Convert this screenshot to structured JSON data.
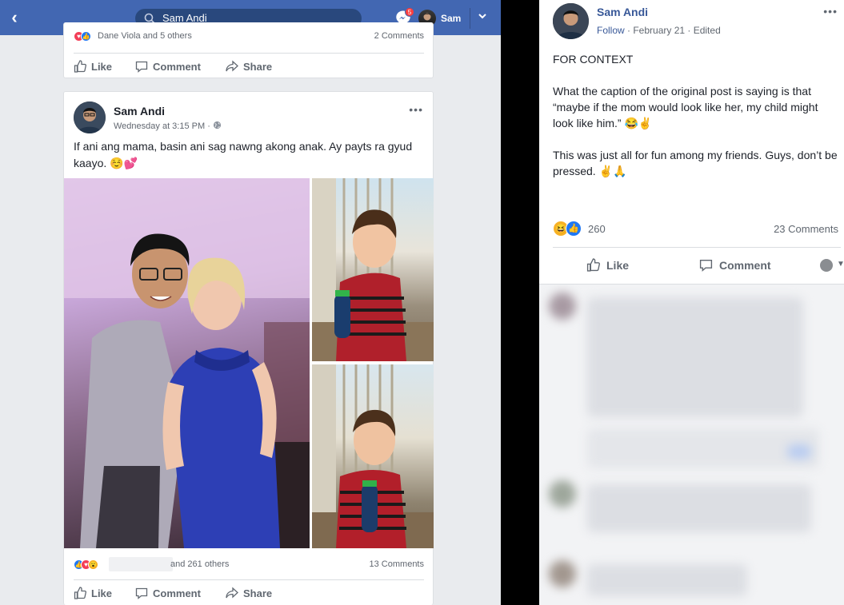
{
  "left_panel": {
    "topbar": {
      "search_value": "Sam Andi",
      "messenger_badge": "5",
      "profile_name": "Sam"
    },
    "previous_post": {
      "reactions_text": "Dane Viola and 5 others",
      "comments_count": "2 Comments",
      "actions": {
        "like": "Like",
        "comment": "Comment",
        "share": "Share"
      }
    },
    "post": {
      "author": "Sam Andi",
      "timestamp": "Wednesday at 3:15 PM · ",
      "text": "If ani ang mama, basin ani sag nawng akong anak. Ay payts ra gyud kaayo. ☺️💕",
      "reactions_text": "and 261 others",
      "comments_count": "13 Comments",
      "actions": {
        "like": "Like",
        "comment": "Comment",
        "share": "Share"
      }
    }
  },
  "right_panel": {
    "author": "Sam Andi",
    "follow": "Follow",
    "meta": " · February 21 · Edited",
    "text_heading": "FOR CONTEXT",
    "text_p1": "What the caption of the original post is saying is that “maybe if the mom would look like her, my child might look like him.” 😂✌️",
    "text_p2": "This was just all for fun among my friends. Guys, don’t be pressed. ✌️🙏",
    "reaction_count": "260",
    "comments_count": "23 Comments",
    "actions": {
      "like": "Like",
      "comment": "Comment"
    }
  },
  "colors": {
    "facebook_blue": "#4267b2",
    "search_bg": "#29487d",
    "page_bg": "#e9ebee",
    "link_blue": "#385898"
  }
}
